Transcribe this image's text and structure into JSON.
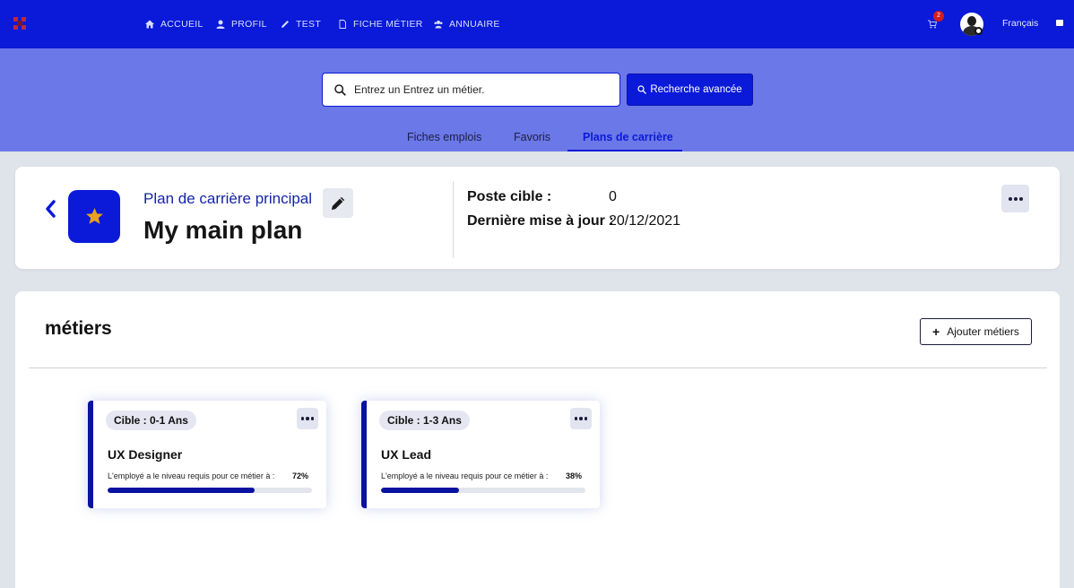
{
  "nav": {
    "items": [
      {
        "label": "ACCUEIL",
        "icon": "home-icon"
      },
      {
        "label": "PROFIL",
        "icon": "user-icon"
      },
      {
        "label": "TEST",
        "icon": "pencil-icon"
      },
      {
        "label": "FICHE MÉTIER",
        "icon": "document-icon"
      },
      {
        "label": "ANNUAIRE",
        "icon": "people-icon"
      }
    ],
    "cart_count": "2",
    "language": "Français"
  },
  "search": {
    "placeholder": "Entrez un Entrez un métier.",
    "advanced_label": "Recherche avancée"
  },
  "tabs": [
    {
      "label": "Fiches emplois",
      "active": false
    },
    {
      "label": "Favoris",
      "active": false
    },
    {
      "label": "Plans de carrière",
      "active": true
    }
  ],
  "plan": {
    "subtitle": "Plan de carrière principal",
    "title": "My main plan",
    "target_label": "Poste cible :",
    "target_value": "0",
    "updated_label": "Dernière mise à jour :",
    "updated_value": "20/12/2021"
  },
  "jobs_section": {
    "title": "métiers",
    "add_label": "Ajouter métiers",
    "jobs": [
      {
        "tag": "Cible : 0-1 Ans",
        "title": "UX Designer",
        "requirement": "L'employé a le niveau requis pour ce métier à :",
        "percent": "72%",
        "progress": 0.72
      },
      {
        "tag": "Cible : 1-3 Ans",
        "title": "UX Lead",
        "requirement": "L'employé a le niveau requis pour ce métier à :",
        "percent": "38%",
        "progress": 0.38
      }
    ]
  },
  "colors": {
    "brand_blue": "#0a1ad8",
    "band_blue": "#6b78e7",
    "star": "#e8a020",
    "badge_red": "#d21d1d"
  }
}
